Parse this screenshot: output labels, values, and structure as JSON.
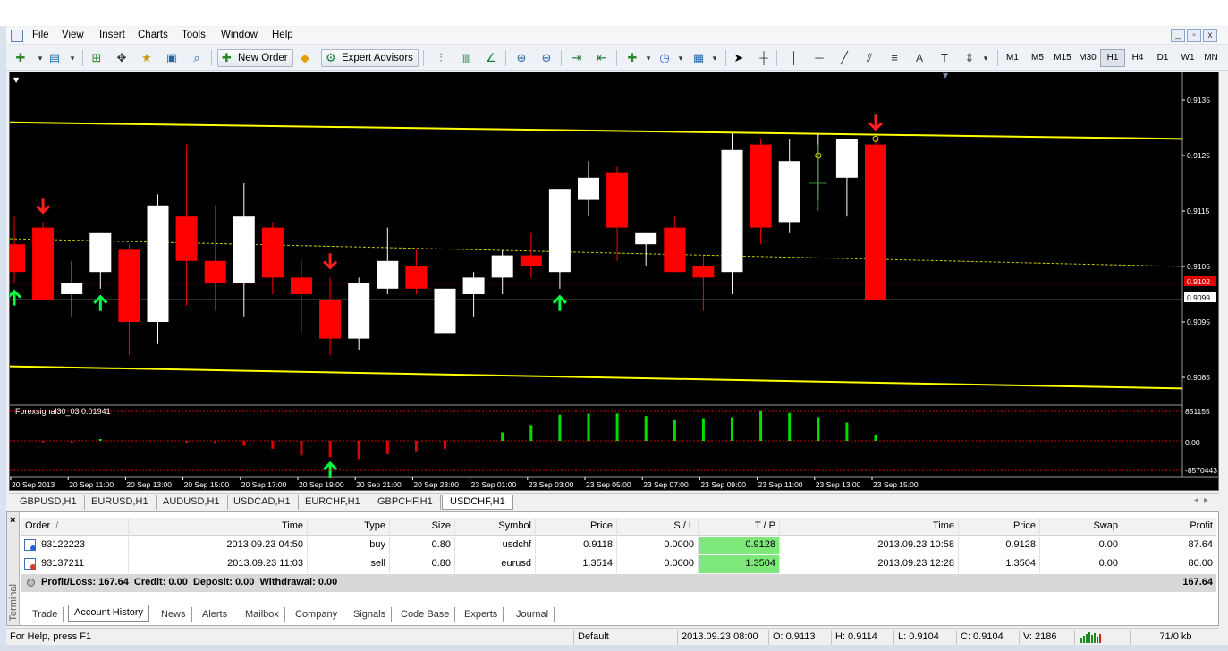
{
  "menu": {
    "items": [
      "File",
      "View",
      "Insert",
      "Charts",
      "Tools",
      "Window",
      "Help"
    ]
  },
  "window_controls": [
    "_",
    "▫",
    "x"
  ],
  "toolbar": {
    "new_order": "New Order",
    "expert_advisors": "Expert Advisors",
    "timeframes": [
      "M1",
      "M5",
      "M15",
      "M30",
      "H1",
      "H4",
      "D1",
      "W1",
      "MN"
    ],
    "active_timeframe": "H1",
    "text_tool": "A"
  },
  "chart": {
    "symbol_tab": "USDCHF,H1",
    "indicator_label": "Forexsignal30_03 0.01941",
    "current_price_red": "0.9102",
    "current_price_white": "0.9099",
    "price_axis": [
      "0.9135",
      "0.9125",
      "0.9115",
      "0.9105",
      "0.9095",
      "0.9085"
    ],
    "indicator_axis": [
      "851155",
      "0.00",
      "-8570443"
    ],
    "time_axis": [
      "20 Sep 2013",
      "20 Sep 11:00",
      "20 Sep 13:00",
      "20 Sep 15:00",
      "20 Sep 17:00",
      "20 Sep 19:00",
      "20 Sep 21:00",
      "20 Sep 23:00",
      "23 Sep 01:00",
      "23 Sep 03:00",
      "23 Sep 05:00",
      "23 Sep 07:00",
      "23 Sep 09:00",
      "23 Sep 11:00",
      "23 Sep 13:00",
      "23 Sep 15:00"
    ],
    "colors": {
      "background": "#000000",
      "bull": "#ffffff",
      "bear": "#ff0000",
      "channel": "#ffff00",
      "histogram_up": "#00e000",
      "histogram_down": "#e00000",
      "arrow_up": "#00ff40",
      "arrow_down": "#ff2020"
    }
  },
  "chart_data": {
    "type": "candlestick",
    "symbol": "USDCHF",
    "timeframe": "H1",
    "candles": [
      {
        "o": 0.9109,
        "h": 0.9114,
        "l": 0.9102,
        "c": 0.9104
      },
      {
        "o": 0.9112,
        "h": 0.9113,
        "l": 0.9099,
        "c": 0.9099
      },
      {
        "o": 0.91,
        "h": 0.9106,
        "l": 0.9096,
        "c": 0.9102
      },
      {
        "o": 0.9104,
        "h": 0.9111,
        "l": 0.9101,
        "c": 0.9111
      },
      {
        "o": 0.9108,
        "h": 0.9109,
        "l": 0.9089,
        "c": 0.9095
      },
      {
        "o": 0.9095,
        "h": 0.9118,
        "l": 0.9091,
        "c": 0.9116
      },
      {
        "o": 0.9114,
        "h": 0.9127,
        "l": 0.9098,
        "c": 0.9106
      },
      {
        "o": 0.9106,
        "h": 0.9116,
        "l": 0.9097,
        "c": 0.9102
      },
      {
        "o": 0.9102,
        "h": 0.912,
        "l": 0.9096,
        "c": 0.9114
      },
      {
        "o": 0.9112,
        "h": 0.9113,
        "l": 0.91,
        "c": 0.9103
      },
      {
        "o": 0.9103,
        "h": 0.9106,
        "l": 0.9093,
        "c": 0.91
      },
      {
        "o": 0.9099,
        "h": 0.9103,
        "l": 0.9089,
        "c": 0.9092
      },
      {
        "o": 0.9092,
        "h": 0.9103,
        "l": 0.909,
        "c": 0.9102
      },
      {
        "o": 0.9101,
        "h": 0.9112,
        "l": 0.91,
        "c": 0.9106
      },
      {
        "o": 0.9105,
        "h": 0.9108,
        "l": 0.91,
        "c": 0.9101
      },
      {
        "o": 0.9093,
        "h": 0.91,
        "l": 0.9087,
        "c": 0.9101
      },
      {
        "o": 0.91,
        "h": 0.9104,
        "l": 0.9096,
        "c": 0.9103
      },
      {
        "o": 0.9103,
        "h": 0.9108,
        "l": 0.91,
        "c": 0.9107
      },
      {
        "o": 0.9107,
        "h": 0.9111,
        "l": 0.9103,
        "c": 0.9105
      },
      {
        "o": 0.9104,
        "h": 0.9118,
        "l": 0.9101,
        "c": 0.9119
      },
      {
        "o": 0.9117,
        "h": 0.9124,
        "l": 0.9114,
        "c": 0.9121
      },
      {
        "o": 0.9122,
        "h": 0.9123,
        "l": 0.9106,
        "c": 0.9112
      },
      {
        "o": 0.9109,
        "h": 0.9111,
        "l": 0.9105,
        "c": 0.9111
      },
      {
        "o": 0.9112,
        "h": 0.9114,
        "l": 0.9104,
        "c": 0.9104
      },
      {
        "o": 0.9105,
        "h": 0.9107,
        "l": 0.9097,
        "c": 0.9103
      },
      {
        "o": 0.9104,
        "h": 0.9129,
        "l": 0.91,
        "c": 0.9126
      },
      {
        "o": 0.9127,
        "h": 0.9128,
        "l": 0.9109,
        "c": 0.9112
      },
      {
        "o": 0.9113,
        "h": 0.9128,
        "l": 0.9111,
        "c": 0.9124
      },
      {
        "o": 0.9125,
        "h": 0.9129,
        "l": 0.9117,
        "c": 0.9125
      },
      {
        "o": 0.9121,
        "h": 0.9128,
        "l": 0.9114,
        "c": 0.9128
      },
      {
        "o": 0.9127,
        "h": 0.9128,
        "l": 0.9099,
        "c": 0.9099
      }
    ],
    "channel_upper": [
      0.9131,
      0.9128
    ],
    "channel_lower": [
      0.9087,
      0.9083
    ],
    "moving_average": [
      0.911,
      0.9105
    ],
    "price_lines": {
      "red": 0.9102,
      "white": 0.9099
    },
    "arrows_down": [
      1,
      11,
      30
    ],
    "arrows_up": [
      0,
      3,
      19
    ],
    "histogram": [
      0,
      -0.05,
      -0.06,
      0.06,
      0,
      0,
      -0.06,
      -0.07,
      -0.16,
      -0.26,
      -0.48,
      -0.54,
      -0.6,
      -0.44,
      -0.34,
      -0.26,
      0,
      0.28,
      0.52,
      0.86,
      0.9,
      0.9,
      0.82,
      0.68,
      0.72,
      0.78,
      0.98,
      0.92,
      0.78,
      0.6,
      0.2
    ],
    "price_ylim": [
      0.908,
      0.914
    ]
  },
  "chart_tabs": [
    "GBPUSD,H1",
    "EURUSD,H1",
    "AUDUSD,H1",
    "USDCAD,H1",
    "EURCHF,H1",
    "GBPCHF,H1",
    "USDCHF,H1"
  ],
  "terminal": {
    "side_label": "Terminal",
    "columns": [
      "Order",
      "Time",
      "Type",
      "Size",
      "Symbol",
      "Price",
      "S / L",
      "T / P",
      "Time",
      "Price",
      "Swap",
      "Profit"
    ],
    "sort_marker": "/",
    "rows": [
      {
        "order": "93122223",
        "time": "2013.09.23 04:50",
        "type": "buy",
        "size": "0.80",
        "symbol": "usdchf",
        "price": "0.9118",
        "sl": "0.0000",
        "tp": "0.9128",
        "close_time": "2013.09.23 10:58",
        "close_price": "0.9128",
        "swap": "0.00",
        "profit": "87.64"
      },
      {
        "order": "93137211",
        "time": "2013.09.23 11:03",
        "type": "sell",
        "size": "0.80",
        "symbol": "eurusd",
        "price": "1.3514",
        "sl": "0.0000",
        "tp": "1.3504",
        "close_time": "2013.09.23 12:28",
        "close_price": "1.3504",
        "swap": "0.00",
        "profit": "80.00"
      }
    ],
    "summary": "Profit/Loss: 167.64  Credit: 0.00  Deposit: 0.00  Withdrawal: 0.00",
    "summary_total": "167.64",
    "tabs": [
      "Trade",
      "Account History",
      "News",
      "Alerts",
      "Mailbox",
      "Company",
      "Signals",
      "Code Base",
      "Experts",
      "Journal"
    ],
    "active_tab": "Account History"
  },
  "status": {
    "help": "For Help, press F1",
    "profile": "Default",
    "datetime": "2013.09.23 08:00",
    "open": "O: 0.9113",
    "high": "H: 0.9114",
    "low": "L: 0.9104",
    "close": "C: 0.9104",
    "volume": "V: 2186",
    "traffic": "71/0 kb"
  }
}
